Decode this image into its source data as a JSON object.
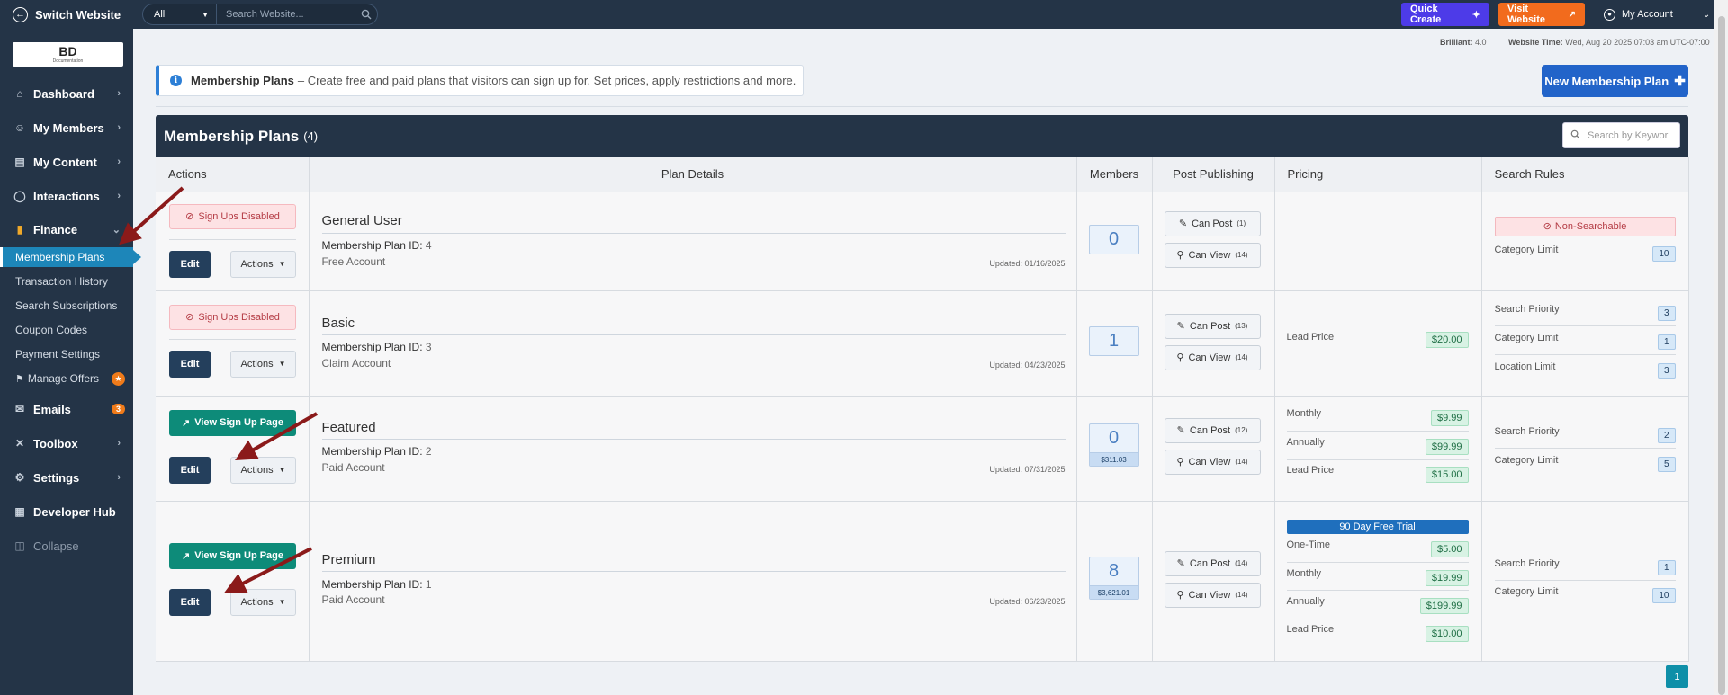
{
  "topbar": {
    "switch_label": "Switch Website",
    "search_scope": "All",
    "search_placeholder": "Search Website...",
    "quick_create": "Quick Create",
    "visit_website": "Visit Website",
    "my_account": "My Account"
  },
  "sidebar": {
    "logo_text": "BD",
    "logo_subtext": "Documentation",
    "items": {
      "dashboard": "Dashboard",
      "my_members": "My Members",
      "my_content": "My Content",
      "interactions": "Interactions",
      "finance": "Finance",
      "emails": "Emails",
      "emails_badge": "3",
      "toolbox": "Toolbox",
      "settings": "Settings",
      "developer_hub": "Developer Hub",
      "collapse": "Collapse"
    },
    "finance_sub": {
      "membership_plans": "Membership Plans",
      "transaction_history": "Transaction History",
      "search_subscriptions": "Search Subscriptions",
      "coupon_codes": "Coupon Codes",
      "payment_settings": "Payment Settings",
      "manage_offers": "Manage Offers"
    }
  },
  "top_info": {
    "brilliant_label": "Brilliant:",
    "brilliant_value": "4.0",
    "website_time_label": "Website Time:",
    "website_time_value": "Wed, Aug 20 2025 07:03 am UTC-07:00"
  },
  "banner": {
    "title": "Membership Plans",
    "text": "– Create free and paid plans that visitors can sign up for. Set prices, apply restrictions and more."
  },
  "new_plan_button": "New Membership Plan",
  "panel": {
    "title": "Membership Plans",
    "count": "(4)",
    "search_placeholder": "Search by Keywor"
  },
  "columns": {
    "actions": "Actions",
    "plan_details": "Plan Details",
    "members": "Members",
    "post_publishing": "Post Publishing",
    "pricing": "Pricing",
    "search_rules": "Search Rules"
  },
  "labels": {
    "sign_ups_disabled": "Sign Ups Disabled",
    "view_sign_up_page": "View Sign Up Page",
    "edit": "Edit",
    "actions": "Actions",
    "membership_plan_id": "Membership Plan ID:",
    "can_post": "Can Post",
    "can_view": "Can View",
    "non_searchable": "Non-Searchable"
  },
  "plans": [
    {
      "name": "General User",
      "id": "4",
      "type": "Free Account",
      "updated": "Updated: 01/16/2025",
      "members": "0",
      "can_post_count": "(1)",
      "can_view_count": "(14)",
      "rules": [
        {
          "label": "Category Limit",
          "value": "10"
        }
      ]
    },
    {
      "name": "Basic",
      "id": "3",
      "type": "Claim Account",
      "updated": "Updated: 04/23/2025",
      "members": "1",
      "can_post_count": "(13)",
      "can_view_count": "(14)",
      "prices": [
        {
          "label": "Lead Price",
          "value": "$20.00"
        }
      ],
      "rules": [
        {
          "label": "Search Priority",
          "value": "3"
        },
        {
          "label": "Category Limit",
          "value": "1"
        },
        {
          "label": "Location Limit",
          "value": "3"
        }
      ]
    },
    {
      "name": "Featured",
      "id": "2",
      "type": "Paid Account",
      "updated": "Updated: 07/31/2025",
      "members": "0",
      "members_amount": "$311.03",
      "can_post_count": "(12)",
      "can_view_count": "(14)",
      "prices": [
        {
          "label": "Monthly",
          "value": "$9.99"
        },
        {
          "label": "Annually",
          "value": "$99.99"
        },
        {
          "label": "Lead Price",
          "value": "$15.00"
        }
      ],
      "rules": [
        {
          "label": "Search Priority",
          "value": "2"
        },
        {
          "label": "Category Limit",
          "value": "5"
        }
      ]
    },
    {
      "name": "Premium",
      "id": "1",
      "type": "Paid Account",
      "updated": "Updated: 06/23/2025",
      "members": "8",
      "members_amount": "$3,621.01",
      "can_post_count": "(14)",
      "can_view_count": "(14)",
      "trial": "90 Day Free Trial",
      "prices": [
        {
          "label": "One-Time",
          "value": "$5.00"
        },
        {
          "label": "Monthly",
          "value": "$19.99"
        },
        {
          "label": "Annually",
          "value": "$199.99"
        },
        {
          "label": "Lead Price",
          "value": "$10.00"
        }
      ],
      "rules": [
        {
          "label": "Search Priority",
          "value": "1"
        },
        {
          "label": "Category Limit",
          "value": "10"
        }
      ]
    }
  ],
  "pagination": {
    "current_page": "1"
  },
  "colors": {
    "annotation_arrow": "#8b1a1a",
    "accent": "#1d86b9",
    "sidebar": "#243447"
  }
}
